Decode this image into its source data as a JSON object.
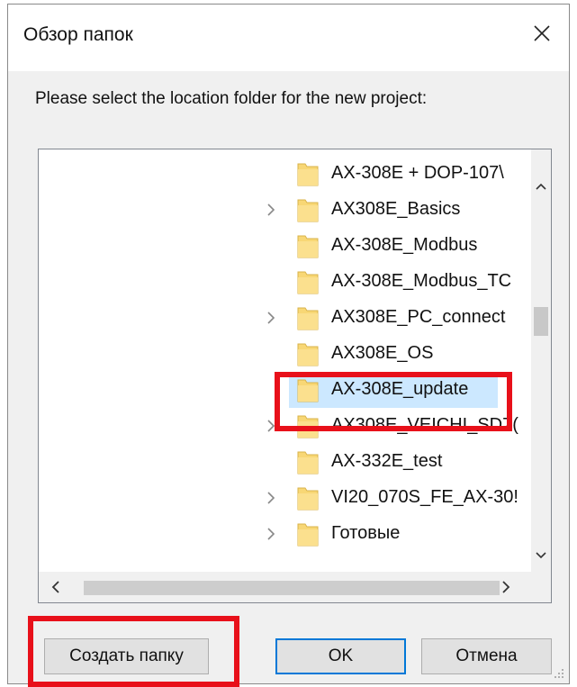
{
  "dialog": {
    "title": "Обзор папок",
    "prompt": "Please select the location folder for the new project:"
  },
  "tree": {
    "items": [
      {
        "label": "AX-308E + DOP-107\\",
        "expandable": false,
        "selected": false
      },
      {
        "label": "AX308E_Basics",
        "expandable": true,
        "selected": false
      },
      {
        "label": "AX-308E_Modbus",
        "expandable": false,
        "selected": false
      },
      {
        "label": "AX-308E_Modbus_TC",
        "expandable": false,
        "selected": false
      },
      {
        "label": "AX308E_PC_connect",
        "expandable": true,
        "selected": false
      },
      {
        "label": "AX308E_OS",
        "expandable": false,
        "selected": false
      },
      {
        "label": "AX-308E_update",
        "expandable": false,
        "selected": true
      },
      {
        "label": "AX308E_VEICHI_SD7(",
        "expandable": true,
        "selected": false
      },
      {
        "label": "AX-332E_test",
        "expandable": false,
        "selected": false
      },
      {
        "label": "VI20_070S_FE_AX-30!",
        "expandable": true,
        "selected": false
      },
      {
        "label": "Готовые",
        "expandable": true,
        "selected": false
      }
    ]
  },
  "buttons": {
    "new_folder": "Создать папку",
    "ok": "OK",
    "cancel": "Отмена"
  },
  "colors": {
    "highlight": "#e8101a",
    "selection": "#cce8ff",
    "folder": "#f8d775",
    "accent": "#0078d7"
  }
}
